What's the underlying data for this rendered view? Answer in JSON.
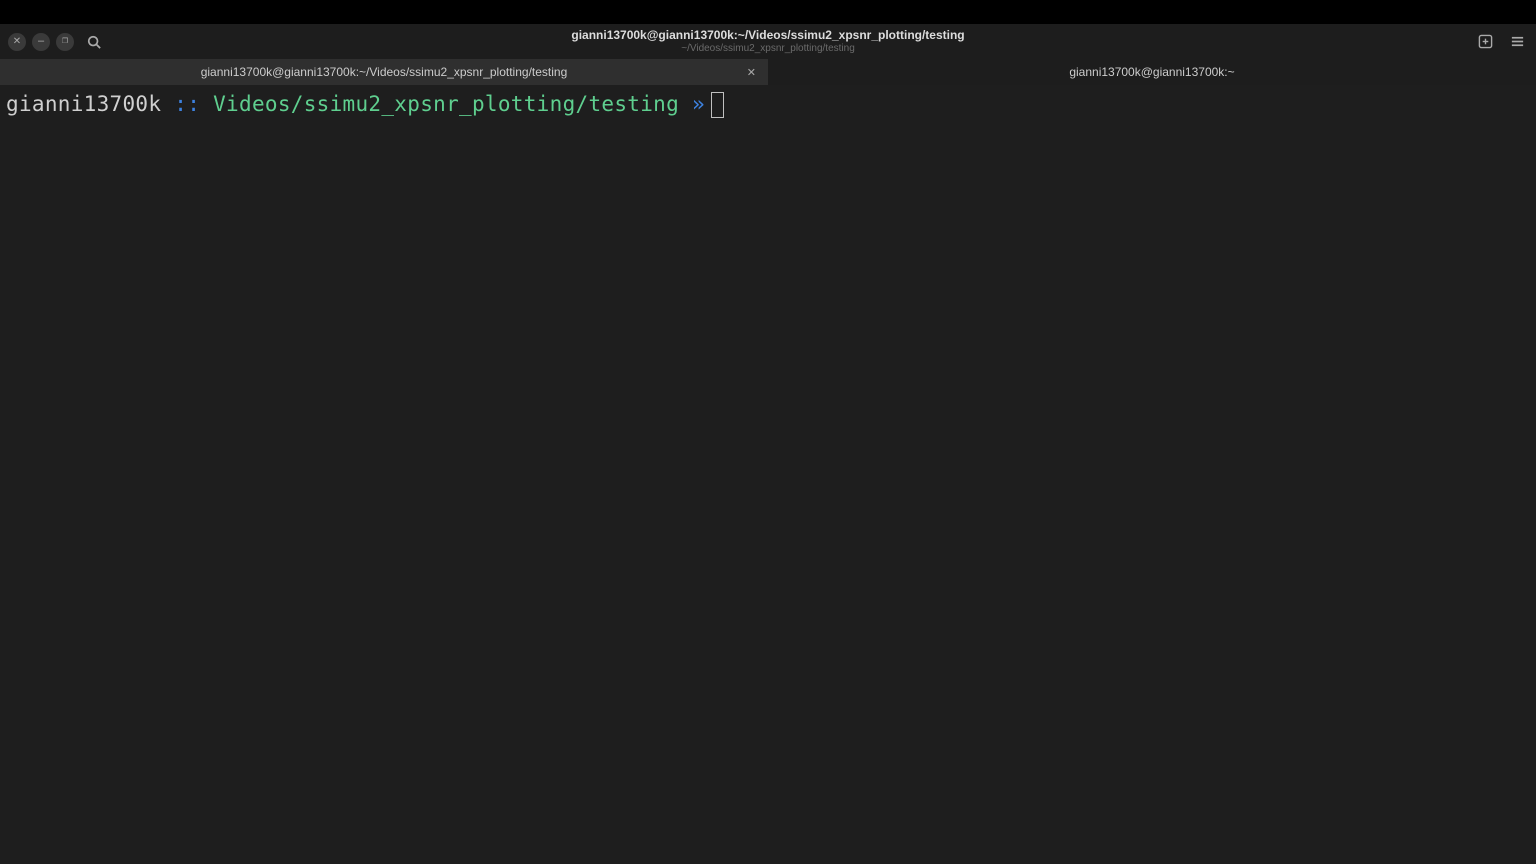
{
  "header": {
    "title": "gianni13700k@gianni13700k:~/Videos/ssimu2_xpsnr_plotting/testing",
    "subtitle": "~/Videos/ssimu2_xpsnr_plotting/testing"
  },
  "tabs": [
    {
      "label": "gianni13700k@gianni13700k:~/Videos/ssimu2_xpsnr_plotting/testing",
      "active": true
    },
    {
      "label": "gianni13700k@gianni13700k:~",
      "active": false
    }
  ],
  "prompt": {
    "user": "gianni13700k",
    "separator": " :: ",
    "path": "Videos/ssimu2_xpsnr_plotting/testing",
    "arrow": " »"
  },
  "icons": {
    "close": "✕",
    "minimize": "–",
    "maximize": "❐",
    "tab_close": "✕"
  }
}
